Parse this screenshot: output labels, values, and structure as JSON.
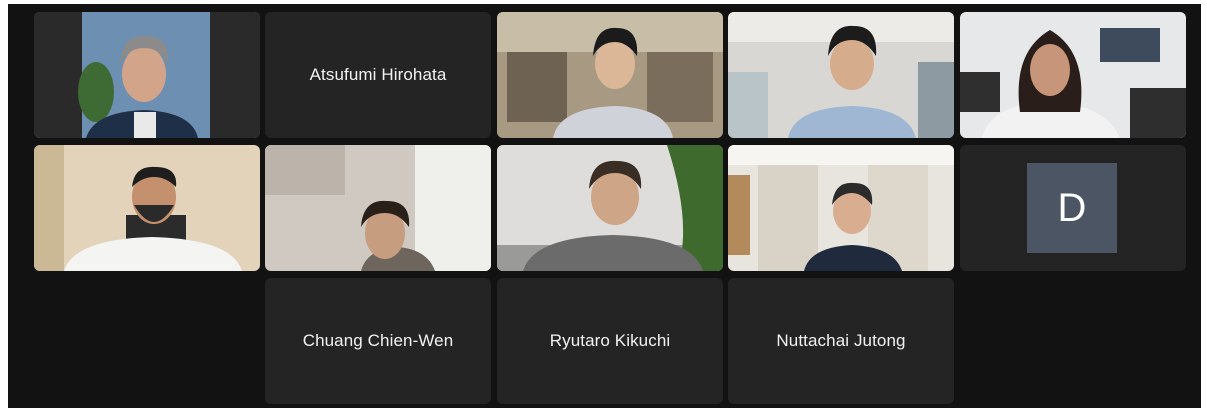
{
  "meeting": {
    "participants": [
      {
        "id": "p1",
        "name": "",
        "video_on": true,
        "active_speaker": true
      },
      {
        "id": "p2",
        "name": "Atsufumi Hirohata",
        "video_on": false
      },
      {
        "id": "p3",
        "name": "",
        "video_on": true
      },
      {
        "id": "p4",
        "name": "",
        "video_on": true
      },
      {
        "id": "p5",
        "name": "",
        "video_on": true
      },
      {
        "id": "p6",
        "name": "",
        "video_on": true
      },
      {
        "id": "p7",
        "name": "",
        "video_on": true
      },
      {
        "id": "p8",
        "name": "",
        "video_on": true
      },
      {
        "id": "p9",
        "name": "",
        "video_on": true
      },
      {
        "id": "p10",
        "initial": "D",
        "video_on": false
      },
      {
        "id": "p11",
        "name": "Chuang Chien-Wen",
        "video_on": false
      },
      {
        "id": "p12",
        "name": "Ryutaro Kikuchi",
        "video_on": false
      },
      {
        "id": "p13",
        "name": "Nuttachai Jutong",
        "video_on": false
      }
    ]
  },
  "colors": {
    "background": "#121212",
    "tile": "#242424",
    "active_border": "#22c55e",
    "avatar": "#4b5563"
  }
}
